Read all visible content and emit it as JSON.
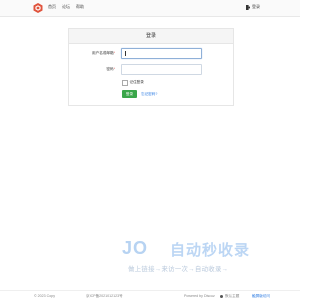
{
  "nav": {
    "home": "首页",
    "forum": "论坛",
    "help": "帮助",
    "login": "登录"
  },
  "login_form": {
    "title": "登录",
    "username_label": "用户名或邮箱",
    "password_label": "密码",
    "required_mark": "*",
    "remember_label": "记住登录",
    "submit_label": "登录",
    "forgot_label": "忘记密码?"
  },
  "watermark": {
    "logo_text": "JO",
    "title": "自动秒收录",
    "subtitle": "做上链接→来访一次→自动收录→"
  },
  "footer": {
    "copyright": "© 2023 Copy",
    "icp": "京ICP备2021012123号",
    "powered": "Powered by Discuz",
    "theme": "默认主题",
    "mobile": "触屏版访问"
  },
  "colors": {
    "accent_green": "#3aa64a",
    "link_blue": "#2a7ae2",
    "logo_red": "#e0533c"
  }
}
